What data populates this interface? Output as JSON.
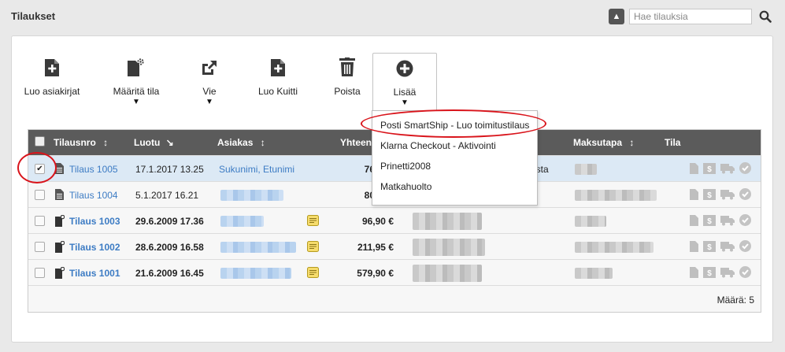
{
  "page_title": "Tilaukset",
  "search": {
    "placeholder": "Hae tilauksia",
    "toggle": "▲"
  },
  "toolbar": {
    "create_docs": "Luo asiakirjat",
    "set_status": "Määritä tila",
    "export": "Vie",
    "create_receipt": "Luo Kuitti",
    "delete": "Poista",
    "more": "Lisää",
    "caret": "▼"
  },
  "columns": {
    "order_no": "Tilausnro",
    "created": "Luotu",
    "customer": "Asiakas",
    "total": "Yhteen",
    "payment": "Maksutapa",
    "status": "Tila"
  },
  "rows": [
    {
      "order": "Tilaus 1005",
      "date": "17.1.2017 13.25",
      "customer": "Sukunimi, Etunimi",
      "total": "76",
      "shipping_tail": "ista",
      "checked": "✔",
      "is_new": false,
      "has_note": false
    },
    {
      "order": "Tilaus 1004",
      "date": "5.1.2017 16.21",
      "customer": "",
      "total": "80",
      "checked": "",
      "is_new": false,
      "has_note": false
    },
    {
      "order": "Tilaus 1003",
      "date": "29.6.2009 17.36",
      "customer": "",
      "total": "96,90 €",
      "checked": "",
      "is_new": true,
      "has_note": true
    },
    {
      "order": "Tilaus 1002",
      "date": "28.6.2009 16.58",
      "customer": "",
      "total": "211,95 €",
      "checked": "",
      "is_new": true,
      "has_note": true
    },
    {
      "order": "Tilaus 1001",
      "date": "21.6.2009 16.45",
      "customer": "",
      "total": "579,90 €",
      "checked": "",
      "is_new": true,
      "has_note": true
    }
  ],
  "footer": {
    "count": "Määrä: 5"
  },
  "dropdown": {
    "items": [
      "Posti SmartShip - Luo toimitustilaus",
      "Klarna Checkout - Aktivointi",
      "Prinetti2008",
      "Matkahuolto"
    ]
  },
  "status_icon_glyph": "$",
  "colors": {
    "header_bg": "#5b5b5b",
    "link": "#3d7cc4",
    "selected_row": "#dce9f5",
    "highlight": "#d9141b"
  }
}
